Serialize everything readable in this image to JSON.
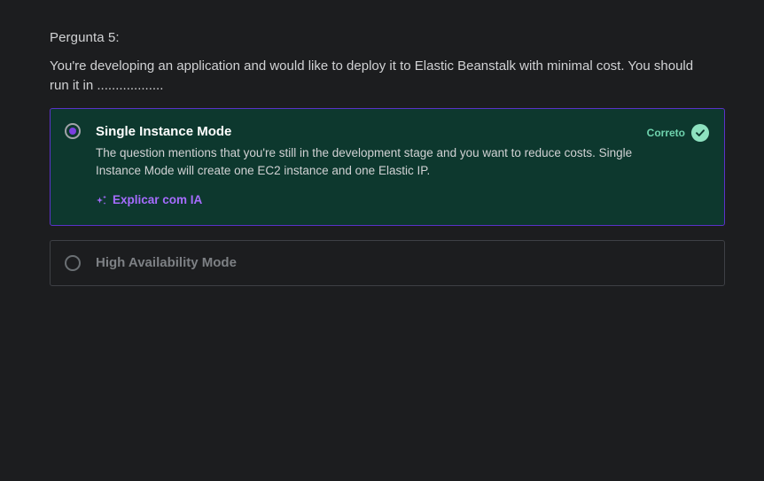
{
  "question": {
    "number_label": "Pergunta 5:",
    "text": "You're developing an application and would like to deploy it to Elastic Beanstalk with minimal cost. You should run it in .................."
  },
  "options": [
    {
      "label": "Single Instance Mode",
      "selected": true,
      "status_label": "Correto",
      "explanation": "The question mentions that you're still in the development stage and you want to reduce costs. Single Instance Mode will create one EC2 instance and one Elastic IP.",
      "ai_link_label": "Explicar com IA"
    },
    {
      "label": "High Availability Mode",
      "selected": false
    }
  ],
  "colors": {
    "background": "#1c1d1f",
    "correct_bg": "#0d382e",
    "correct_border": "#5b32c9",
    "accent_purple": "#a66cff",
    "correct_green": "#6fd3ae"
  },
  "icons": {
    "ai_link": "sparkle-icon",
    "correct": "check-circle-icon"
  }
}
